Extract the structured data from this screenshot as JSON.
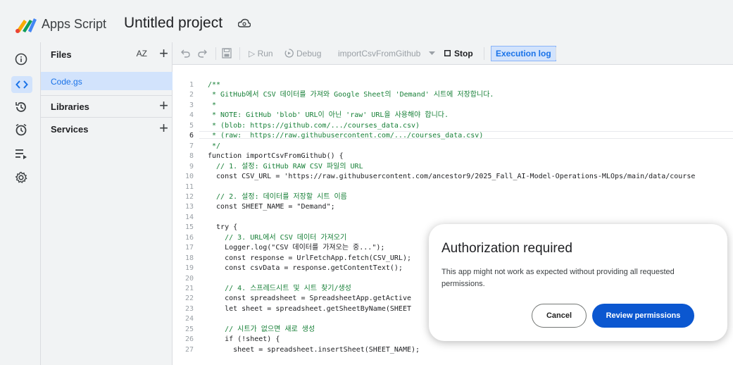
{
  "header": {
    "app_name": "Apps Script",
    "project_title": "Untitled project",
    "logo_icon": "apps-script-logo",
    "cloud_icon": "cloud-sync-icon"
  },
  "rail": {
    "icons": [
      "info-icon",
      "code-icon",
      "history-icon",
      "triggers-icon",
      "executions-icon",
      "settings-icon"
    ],
    "active": "code-icon"
  },
  "files_panel": {
    "files_label": "Files",
    "sort_label": "AZ",
    "file": "Code.gs",
    "libraries_label": "Libraries",
    "services_label": "Services"
  },
  "toolbar": {
    "run": "▷ Run",
    "debug": "Debug",
    "function_name": "importCsvFromGithub",
    "stop": "Stop",
    "execution_log": "Execution log"
  },
  "code": {
    "current_line": 6,
    "lines": [
      "/**",
      " * GitHub에서 CSV 데이터를 가져와 Google Sheet의 'Demand' 시트에 저장합니다.",
      " *",
      " * NOTE: GitHub 'blob' URL이 아닌 'raw' URL을 사용해야 합니다.",
      " * (blob: https://github.com/.../courses_data.csv)",
      " * (raw:  https://raw.githubusercontent.com/.../courses_data.csv)",
      " */",
      "function importCsvFromGithub() {",
      "  // 1. 설정: GitHub RAW CSV 파일의 URL",
      "  const CSV_URL = 'https://raw.githubusercontent.com/ancestor9/2025_Fall_AI-Model-Operations-MLOps/main/data/course",
      "",
      "  // 2. 설정: 데이터를 저장할 시트 이름",
      "  const SHEET_NAME = \"Demand\";",
      "",
      "  try {",
      "    // 3. URL에서 CSV 데이터 가져오기",
      "    Logger.log(\"CSV 데이터를 가져오는 중...\");",
      "    const response = UrlFetchApp.fetch(CSV_URL);",
      "    const csvData = response.getContentText();",
      "",
      "    // 4. 스프레드시트 및 시트 찾기/생성",
      "    const spreadsheet = SpreadsheetApp.getActive",
      "    let sheet = spreadsheet.getSheetByName(SHEET",
      "",
      "    // 시트가 없으면 새로 생성",
      "    if (!sheet) {",
      "      sheet = spreadsheet.insertSheet(SHEET_NAME);"
    ]
  },
  "dialog": {
    "title": "Authorization required",
    "body": "This app might not work as expected without providing all requested permissions.",
    "cancel": "Cancel",
    "review": "Review permissions"
  },
  "colors": {
    "accent": "#0b57d0",
    "active_bg": "#d2e3fc",
    "link": "#1a73e8"
  }
}
